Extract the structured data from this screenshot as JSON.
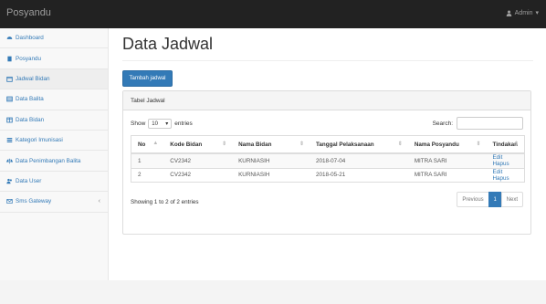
{
  "app": {
    "brand": "Posyandu",
    "user": "Admin"
  },
  "sidebar": {
    "items": [
      {
        "label": "Dashboard",
        "icon": "dashboard-icon"
      },
      {
        "label": "Posyandu",
        "icon": "building-icon"
      },
      {
        "label": "Jadwal Bidan",
        "icon": "calendar-icon"
      },
      {
        "label": "Data Balita",
        "icon": "table-icon"
      },
      {
        "label": "Data Bidan",
        "icon": "table-icon"
      },
      {
        "label": "Kategori Imunisasi",
        "icon": "list-icon"
      },
      {
        "label": "Data Penimbangan Balita",
        "icon": "scale-icon"
      },
      {
        "label": "Data User",
        "icon": "users-icon"
      },
      {
        "label": "Sms Gateway",
        "icon": "mail-icon"
      }
    ]
  },
  "page": {
    "title": "Data Jadwal",
    "add_button": "Tambah jadwal"
  },
  "panel": {
    "heading": "Tabel Jadwal",
    "show_label": "Show",
    "entries_value": "10",
    "entries_label": "entries",
    "search_label": "Search:",
    "columns": [
      "No",
      "Kode Bidan",
      "Nama Bidan",
      "Tanggal Pelaksanaan",
      "Nama Posyandu",
      "Tindakan"
    ],
    "rows": [
      {
        "no": "1",
        "kode": "CV2342",
        "nama": "KURNIASIH",
        "tanggal": "2018-07-04",
        "posyandu": "MITRA SARI",
        "edit": "Edit",
        "hapus": "Hapus"
      },
      {
        "no": "2",
        "kode": "CV2342",
        "nama": "KURNIASIH",
        "tanggal": "2018-05-21",
        "posyandu": "MITRA SARI",
        "edit": "Edit",
        "hapus": "Hapus"
      }
    ],
    "info": "Showing 1 to 2 of 2 entries",
    "pager": {
      "previous": "Previous",
      "current": "1",
      "next": "Next"
    }
  },
  "colors": {
    "primary": "#337ab7",
    "navbar": "#222222"
  }
}
